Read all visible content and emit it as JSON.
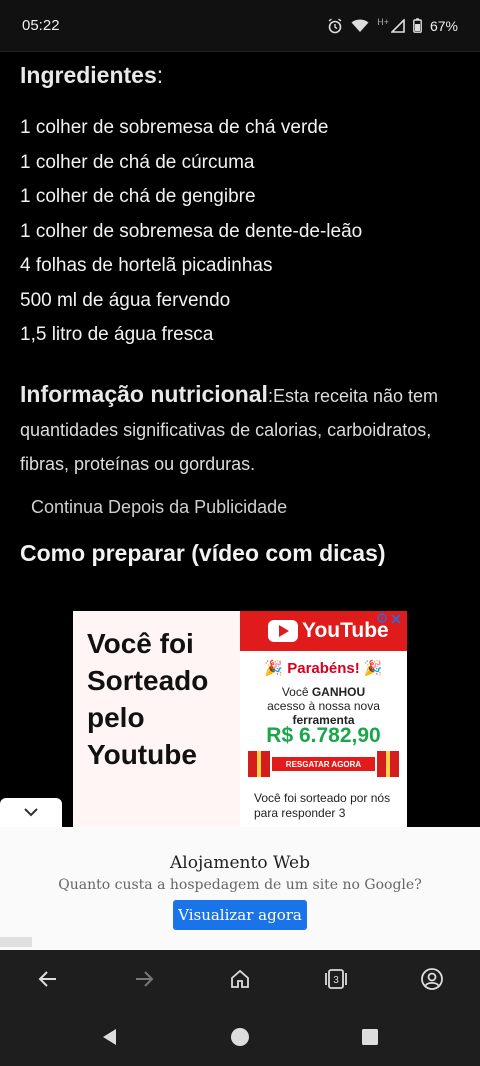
{
  "status": {
    "time": "05:22",
    "network": "H+",
    "battery": "67%"
  },
  "article": {
    "ingredients_title": "Ingredientes",
    "ingredients_colon": ":",
    "ingredients": [
      "1 colher de sobremesa de chá verde",
      "1 colher de chá de cúrcuma",
      "1 colher de chá de gengibre",
      "1 colher de sobremesa de dente-de-leão",
      "4 folhas de hortelã picadinhas",
      "500 ml de água fervendo",
      "1,5 litro de água fresca"
    ],
    "nutrition_title": "Informação nutricional",
    "nutrition_text": ":Esta receita não tem quantidades significativas de calorias, carboidratos, fibras, proteínas ou gorduras.",
    "continue_text": "Continua Depois da Publicidade",
    "how_to_title": "Como preparar (vídeo com dicas)"
  },
  "ad": {
    "headline": "Você foi Sorteado pelo Youtube",
    "brand": "YouTube",
    "congrats": "🎉 Parabéns! 🎉",
    "won_prefix": "Você ",
    "won_bold": "GANHOU",
    "won_rest": "acesso à nossa nova",
    "tool": "ferramenta",
    "amount": "R$ 6.782,90",
    "cta": "RESGATAR AGORA",
    "footer": "Você foi sorteado por nós para responder 3"
  },
  "banner": {
    "title": "Alojamento Web",
    "subtitle": "Quanto custa a hospedagem de um site no Google?",
    "button": "Visualizar agora"
  },
  "browser_nav": {
    "tab_count": "3"
  },
  "icons": {
    "back": "arrow-left-icon",
    "forward": "arrow-right-icon",
    "home": "home-icon",
    "tabs": "tabs-icon",
    "account": "account-icon"
  }
}
